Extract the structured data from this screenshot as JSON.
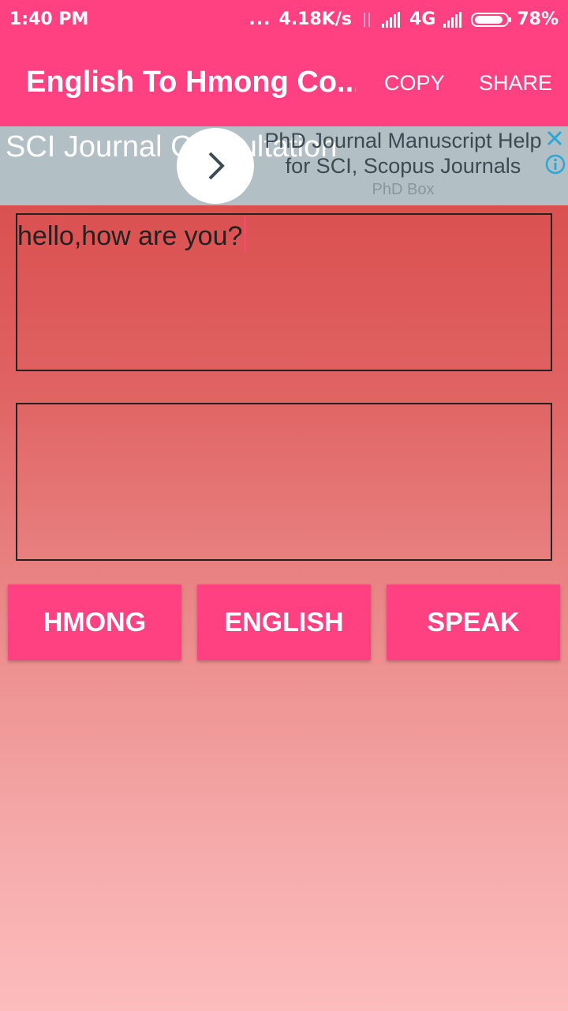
{
  "status_bar": {
    "time": "1:40 PM",
    "dots": "...",
    "speed": "4.18K/s",
    "network": "4G",
    "battery": "78%"
  },
  "toolbar": {
    "title": "English To Hmong Co...",
    "copy_label": "COPY",
    "share_label": "SHARE",
    "color": "#ff4081"
  },
  "ad": {
    "left_text": "SCI Journal Consultation",
    "headline": "PhD Journal Manuscript Help for SCI, Scopus Journals",
    "source": "PhD Box",
    "icons": [
      "chevron-right-icon",
      "close-icon",
      "info-icon"
    ]
  },
  "input": {
    "value": "hello,how are you?"
  },
  "output": {
    "value": ""
  },
  "buttons": {
    "hmong": "HMONG",
    "english": "ENGLISH",
    "speak": "SPEAK"
  }
}
